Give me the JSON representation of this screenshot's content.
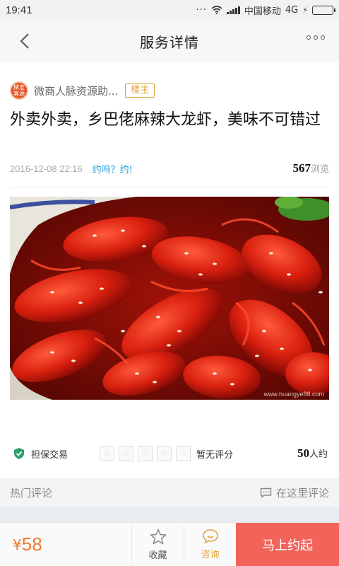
{
  "status_bar": {
    "time": "19:41",
    "carrier": "中国移动",
    "network": "4G"
  },
  "nav": {
    "title": "服务详情",
    "back_icon": "chevron-left-icon",
    "more_icon": "more-dots-icon"
  },
  "author": {
    "avatar_text": "精准客源",
    "name": "微商人脉资源助...",
    "badge": "楼主"
  },
  "post": {
    "title": "外卖外卖，乡巴佬麻辣大龙虾，美味不可错过",
    "date": "2016-12-08 22:16",
    "tag": "约吗？约!",
    "views_count": "567",
    "views_label": "浏览",
    "photo_watermark": "www.huangye88.com"
  },
  "info": {
    "guarantee": "担保交易",
    "rating_stars": 0,
    "rating_max": 5,
    "rating_text": "暂无评分",
    "appointments_count": "50",
    "appointments_label": "人约"
  },
  "comments": {
    "title": "热门评论",
    "write_label": "在这里评论"
  },
  "bottom_bar": {
    "currency": "¥",
    "price": "58",
    "favorite_label": "收藏",
    "consult_label": "咨询",
    "book_label": "马上约起"
  },
  "colors": {
    "accent_orange": "#ee7b2b",
    "link_blue": "#1a9ed9",
    "badge_gold": "#e0a23a",
    "book_red": "#f2645a",
    "shield_green": "#2e9e6a"
  }
}
